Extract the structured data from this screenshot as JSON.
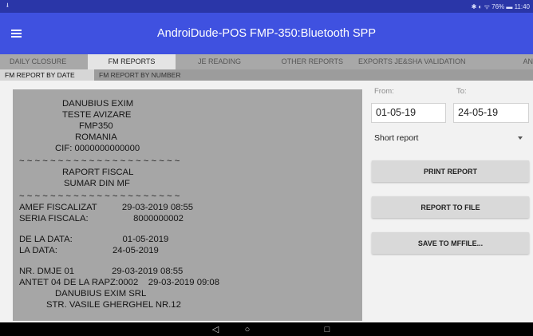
{
  "status_bar": {
    "left_icon": "usb-icon",
    "right_text": "✱ ◐ ᯤ 76% ▬ 11:40"
  },
  "app_bar": {
    "menu_icon": "hamburger-menu-icon",
    "title": "AndroiDude-POS   FMP-350:Bluetooth SPP"
  },
  "tabs": [
    {
      "label": "DAILY CLOSURE",
      "active": false
    },
    {
      "label": "FM REPORTS",
      "active": true
    },
    {
      "label": "JE READING",
      "active": false
    },
    {
      "label": "OTHER REPORTS",
      "active": false
    },
    {
      "label": "EXPORTS JE&SHA VALIDATION",
      "active": false
    },
    {
      "label": "AN",
      "active": false
    }
  ],
  "subtabs": [
    {
      "label": "FM REPORT BY DATE",
      "active": true
    },
    {
      "label": "FM REPORT BY NUMBER",
      "active": false
    }
  ],
  "report_lines": [
    "DANUBIUS EXIM",
    "TESTE AVIZARE",
    "FMP350",
    "ROMANIA",
    "CIF: 0000000000000",
    "~ ~ ~ ~ ~ ~ ~ ~ ~ ~ ~ ~ ~ ~ ~ ~ ~ ~ ~ ~ ~",
    "RAPORT FISCAL",
    "SUMAR DIN MF",
    "~ ~ ~ ~ ~ ~ ~ ~ ~ ~ ~ ~ ~ ~ ~ ~ ~ ~ ~ ~ ~",
    "AMEF FISCALIZAT          29-03-2019 08:55",
    "SERIA FISCALA:                  8000000002",
    "DE LA DATA:                    01-05-2019",
    "LA DATA:                      24-05-2019",
    "NR. DMJE 01               29-03-2019 08:55",
    "ANTET 04 DE LA RAPZ:0002    29-03-2019 09:08",
    "DANUBIUS EXIM SRL",
    "STR. VASILE GHERGHEL NR.12"
  ],
  "form": {
    "from_label": "From:",
    "from_value": "01-05-19",
    "to_label": "To:",
    "to_value": "24-05-19",
    "report_type": "Short report"
  },
  "buttons": {
    "print": "PRINT REPORT",
    "to_file": "REPORT TO FILE",
    "mffile": "SAVE TO MFFILE..."
  },
  "nav": {
    "back": "◁",
    "home": "○",
    "recents": "□"
  }
}
